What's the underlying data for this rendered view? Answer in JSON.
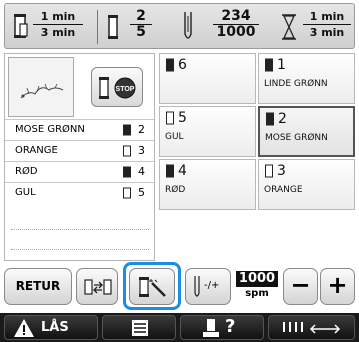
{
  "topbar": {
    "time_frac": {
      "num": "1 min",
      "den": "3 min"
    },
    "color_frac": {
      "num": "2",
      "den": "5"
    },
    "stitch_frac": {
      "num": "234",
      "den": "1000"
    },
    "timer_frac": {
      "num": "1 min",
      "den": "3 min"
    }
  },
  "left": {
    "stop_label": "STOP",
    "rows": [
      {
        "name": "MOSE GRØNN",
        "number": "2",
        "filled": true
      },
      {
        "name": "ORANGE",
        "number": "3",
        "filled": false
      },
      {
        "name": "RØD",
        "number": "4",
        "filled": true
      },
      {
        "name": "GUL",
        "number": "5",
        "filled": false
      }
    ]
  },
  "grid": {
    "cells": [
      {
        "number": "6",
        "color": "",
        "filled": true
      },
      {
        "number": "1",
        "color": "LINDE GRØNN",
        "filled": true
      },
      {
        "number": "5",
        "color": "GUL",
        "filled": false
      },
      {
        "number": "2",
        "color": "MOSE GRØNN",
        "filled": true
      },
      {
        "number": "4",
        "color": "RØD",
        "filled": true
      },
      {
        "number": "3",
        "color": "ORANGE",
        "filled": false
      }
    ]
  },
  "controls": {
    "retur_label": "RETUR",
    "speed_value": "1000",
    "speed_unit": "spm",
    "stitch_adjust": "-/+",
    "minus": "−",
    "plus": "+"
  },
  "nav": {
    "lock_label": "LÅS",
    "help_label": "?"
  },
  "colors": {
    "highlight": "#1a8fe0",
    "nav_bg": "#1a1a1a"
  }
}
